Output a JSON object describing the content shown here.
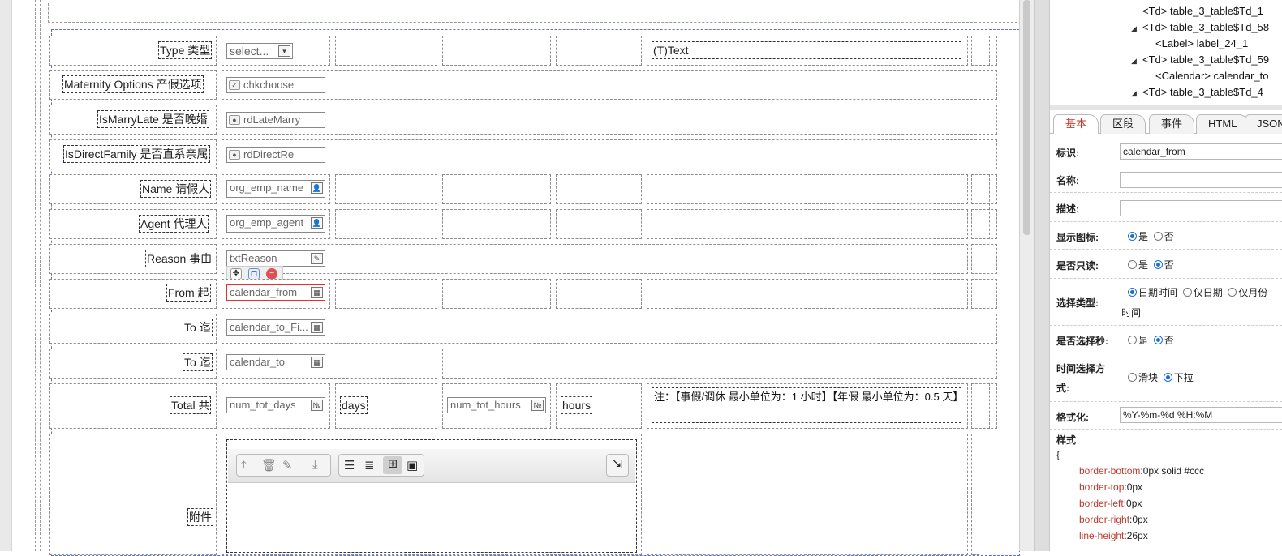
{
  "form": {
    "row_type": {
      "label": "Type 类型",
      "select_placeholder": "select...",
      "text_field": "(T)Text"
    },
    "row_maternity": {
      "label": "Maternity Options 产假选项",
      "control": "chkchoose"
    },
    "row_marry": {
      "label": "IsMarryLate 是否晚婚",
      "control": "rdLateMarry"
    },
    "row_family": {
      "label": "IsDirectFamily 是否直系亲属",
      "control": "rdDirectRe"
    },
    "row_name": {
      "label": "Name 请假人",
      "control": "org_emp_name"
    },
    "row_agent": {
      "label": "Agent 代理人",
      "control": "org_emp_agent"
    },
    "row_reason": {
      "label": "Reason 事由",
      "control": "txtReason"
    },
    "row_from": {
      "label": "From 起",
      "control": "calendar_from"
    },
    "row_to1": {
      "label": "To 迄",
      "control": "calendar_to_Fi..."
    },
    "row_to2": {
      "label": "To 迄",
      "control": "calendar_to"
    },
    "row_total": {
      "label": "Total 共",
      "days_field": "num_tot_days",
      "days_label": "days",
      "hours_field": "num_tot_hours",
      "hours_label": "hours",
      "note": "注：【事假/调休 最小单位为：1 小时】【年假 最小单位为：0.5 天】"
    },
    "row_attach": {
      "label": "附件"
    }
  },
  "tree": {
    "rows": [
      {
        "text": "<Td> table_3_table$Td_1",
        "expander": false
      },
      {
        "text": "<Td> table_3_table$Td_58",
        "expander": true
      },
      {
        "text": "<Label> label_24_1",
        "expander": false
      },
      {
        "text": "<Td> table_3_table$Td_59",
        "expander": true
      },
      {
        "text": "<Calendar> calendar_to",
        "expander": false
      },
      {
        "text": "<Td> table_3_table$Td_4",
        "expander": true
      }
    ]
  },
  "tabs": [
    "基本",
    "区段",
    "事件",
    "HTML",
    "JSON"
  ],
  "props": {
    "id_label": "标识:",
    "id_value": "calendar_from",
    "name_label": "名称:",
    "desc_label": "描述:",
    "showicon_label": "显示图标:",
    "showicon_yes": "是",
    "showicon_no": "否",
    "readonly_label": "是否只读:",
    "readonly_yes": "是",
    "readonly_no": "否",
    "seltype_label": "选择类型:",
    "seltype_opt1": "日期时间",
    "seltype_opt2": "仅日期",
    "seltype_opt3": "仅月份",
    "seltype_cont": "时间",
    "selsec_label": "是否选择秒:",
    "selsec_yes": "是",
    "selsec_no": "否",
    "timemode_label1": "时间选择方",
    "timemode_label2": "式:",
    "timemode_opt1": "滑块",
    "timemode_opt2": "下拉",
    "format_label": "格式化:",
    "format_value": "%Y-%m-%d %H:%M",
    "style_label": "样式"
  },
  "css": {
    "open": "{",
    "lines": [
      {
        "k": "border-bottom",
        "v": ":0px solid #ccc"
      },
      {
        "k": "border-top",
        "v": ":0px"
      },
      {
        "k": "border-left",
        "v": ":0px"
      },
      {
        "k": "border-right",
        "v": ":0px"
      },
      {
        "k": "line-height",
        "v": ":26px"
      }
    ]
  }
}
